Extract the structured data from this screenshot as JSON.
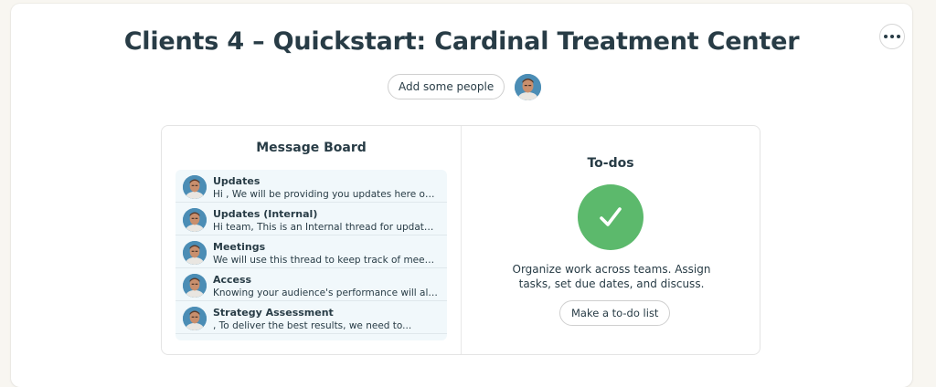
{
  "project": {
    "title": "Clients 4 – Quickstart: Cardinal Treatment Center",
    "add_people_label": "Add some people",
    "more_icon": "ellipsis-icon"
  },
  "colors": {
    "page_bg": "#f8f6f1",
    "text": "#283c46",
    "message_list_bg": "#f1f8fb",
    "todo_check": "#5cb96c",
    "avatar_bg": "#4b8db5"
  },
  "message_board": {
    "title": "Message Board",
    "messages": [
      {
        "title": "Updates",
        "excerpt": "Hi , We will be providing you updates here on..."
      },
      {
        "title": "Updates (Internal)",
        "excerpt": "Hi team, This is an Internal thread for updates. W..."
      },
      {
        "title": "Meetings",
        "excerpt": "We will use this thread to keep track of meetings..."
      },
      {
        "title": "Access",
        "excerpt": "Knowing your audience's performance will allow..."
      },
      {
        "title": "Strategy Assessment",
        "excerpt": ", To deliver the best results, we need to..."
      }
    ]
  },
  "todos": {
    "title": "To-dos",
    "icon": "checkmark-icon",
    "description": "Organize work across teams. Assign tasks, set due dates, and discuss.",
    "button_label": "Make a to-do list"
  }
}
